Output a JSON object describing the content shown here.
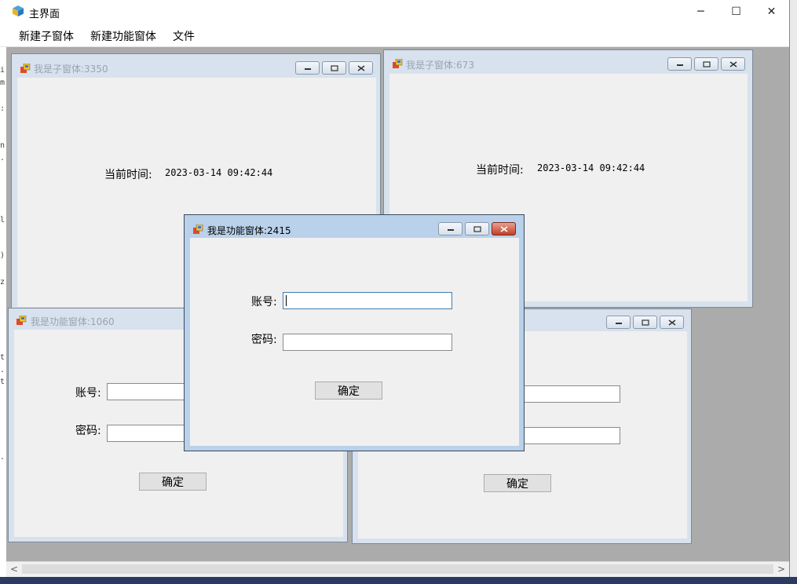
{
  "main": {
    "title": "主界面",
    "menu": [
      "新建子窗体",
      "新建功能窗体",
      "文件"
    ],
    "caption_buttons": {
      "minimize": "─",
      "maximize": "☐",
      "close": "✕"
    },
    "scroll": {
      "left": "<",
      "right": ">"
    }
  },
  "children": {
    "child_3350": {
      "title": "我是子窗体:3350",
      "time_label": "当前时间:",
      "time_value": "2023-03-14 09:42:44"
    },
    "child_673": {
      "title": "我是子窗体:673",
      "time_label": "当前时间:",
      "time_value": "2023-03-14 09:42:44"
    },
    "func_1060": {
      "title": "我是功能窗体:1060",
      "account_label": "账号:",
      "password_label": "密码:",
      "ok_label": "确定"
    },
    "func_hidden": {
      "ok_label": "确定"
    },
    "func_2415": {
      "title": "我是功能窗体:2415",
      "account_label": "账号:",
      "password_label": "密码:",
      "ok_label": "确定"
    }
  },
  "edge_chars": [
    "i",
    "m",
    ":",
    "n",
    ".",
    "l",
    ")",
    "z",
    "t",
    ".",
    "t",
    "."
  ]
}
